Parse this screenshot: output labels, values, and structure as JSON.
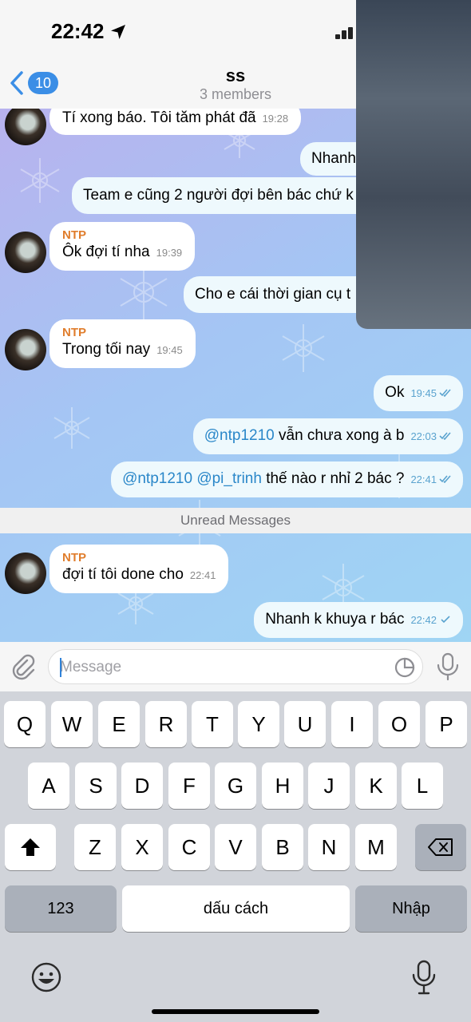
{
  "status_bar": {
    "time": "22:42",
    "location_icon": "location-arrow-icon",
    "signal_icon": "cellular-signal-icon"
  },
  "header": {
    "back_count": "10",
    "title": "ss",
    "subtitle": "3 members"
  },
  "messages": [
    {
      "dir": "in",
      "text": "Tí xong báo. Tôi tăm phát đã",
      "time": "19:28"
    },
    {
      "dir": "out",
      "text": "Nhanh"
    },
    {
      "dir": "out",
      "text": "Team e cũng 2 người đợi bên bác chứ k"
    },
    {
      "dir": "in",
      "sender": "NTP",
      "text": "Ôk đợi tí nha",
      "time": "19:39"
    },
    {
      "dir": "out",
      "text": "Cho e cái thời gian cụ t"
    },
    {
      "dir": "in",
      "sender": "NTP",
      "text": "Trong tối nay",
      "time": "19:45"
    },
    {
      "dir": "out",
      "text": "Ok",
      "time": "19:45"
    },
    {
      "dir": "out",
      "mention": "@ntp1210",
      "text": " vẫn chưa xong à b",
      "time": "22:03"
    },
    {
      "dir": "out",
      "mention": "@ntp1210 @pi_trinh",
      "text": " thế nào r nhỉ 2 bác ?",
      "time": "22:41"
    },
    {
      "dir": "in",
      "sender": "NTP",
      "text": "đợi tí tôi done cho",
      "time": "22:41"
    },
    {
      "dir": "out",
      "text": "Nhanh k khuya r bác",
      "time": "22:42"
    }
  ],
  "unread_divider": "Unread Messages",
  "input": {
    "placeholder": "Message"
  },
  "keyboard": {
    "row1": [
      "Q",
      "W",
      "E",
      "R",
      "T",
      "Y",
      "U",
      "I",
      "O",
      "P"
    ],
    "row2": [
      "A",
      "S",
      "D",
      "F",
      "G",
      "H",
      "J",
      "K",
      "L"
    ],
    "row3": [
      "Z",
      "X",
      "C",
      "V",
      "B",
      "N",
      "M"
    ],
    "numbers_key": "123",
    "space_key": "dấu cách",
    "return_key": "Nhập"
  },
  "colors": {
    "accent": "#3b8ee6",
    "sender_name": "#e07d2c",
    "mention": "#2a87c9",
    "keyboard_bg": "#d1d4da"
  }
}
